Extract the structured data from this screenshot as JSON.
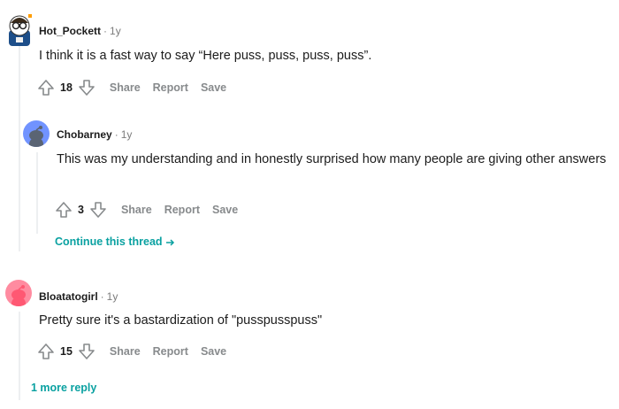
{
  "comments": [
    {
      "author": "Hot_Pockett",
      "age": "1y",
      "text": "I think it is a fast way to say “Here puss, puss, puss, puss”.",
      "score": "18",
      "share": "Share",
      "report": "Report",
      "save": "Save"
    },
    {
      "author": "Chobarney",
      "age": "1y",
      "text": "This was my understanding and in honestly surprised how many people are giving other answers",
      "score": "3",
      "share": "Share",
      "report": "Report",
      "save": "Save",
      "continue_label": "Continue this thread"
    },
    {
      "author": "Bloatatogirl",
      "age": "1y",
      "text": "Pretty sure it's a bastardization of \"pusspusspuss\"",
      "score": "15",
      "share": "Share",
      "report": "Report",
      "save": "Save",
      "more_replies": "1 more reply"
    }
  ],
  "colors": {
    "accent_teal": "#0aa1a1",
    "muted": "#878a8c",
    "thread_line": "#edeff1"
  }
}
